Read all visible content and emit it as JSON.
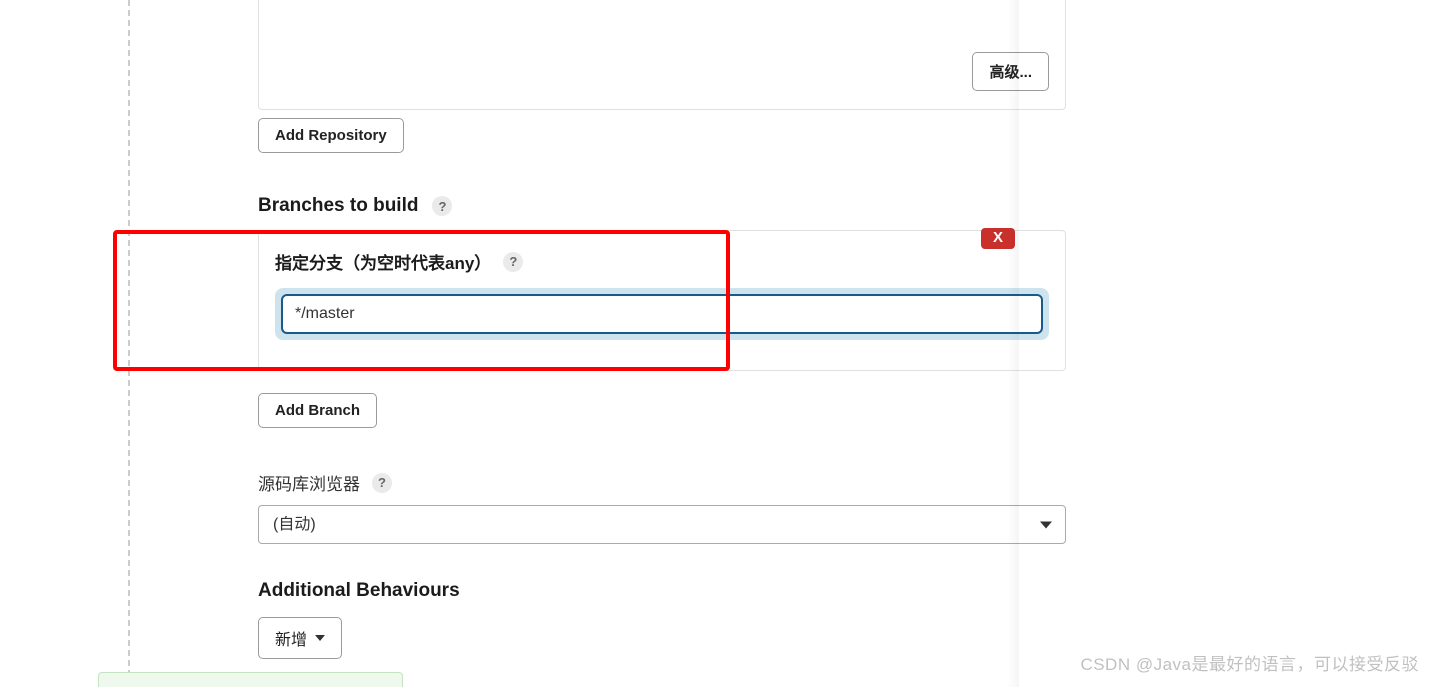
{
  "buttons": {
    "advanced": "高级...",
    "add_repository": "Add Repository",
    "add_branch": "Add Branch",
    "add_new": "新增"
  },
  "headings": {
    "branches_to_build": "Branches to build",
    "additional_behaviours": "Additional Behaviours"
  },
  "branch_section": {
    "field_label": "指定分支（为空时代表any）",
    "value": "*/master",
    "delete_label": "X"
  },
  "repo_browser": {
    "label": "源码库浏览器",
    "selected": "(自动)"
  },
  "help_glyph": "?",
  "watermark": "CSDN @Java是最好的语言，可以接受反驳"
}
